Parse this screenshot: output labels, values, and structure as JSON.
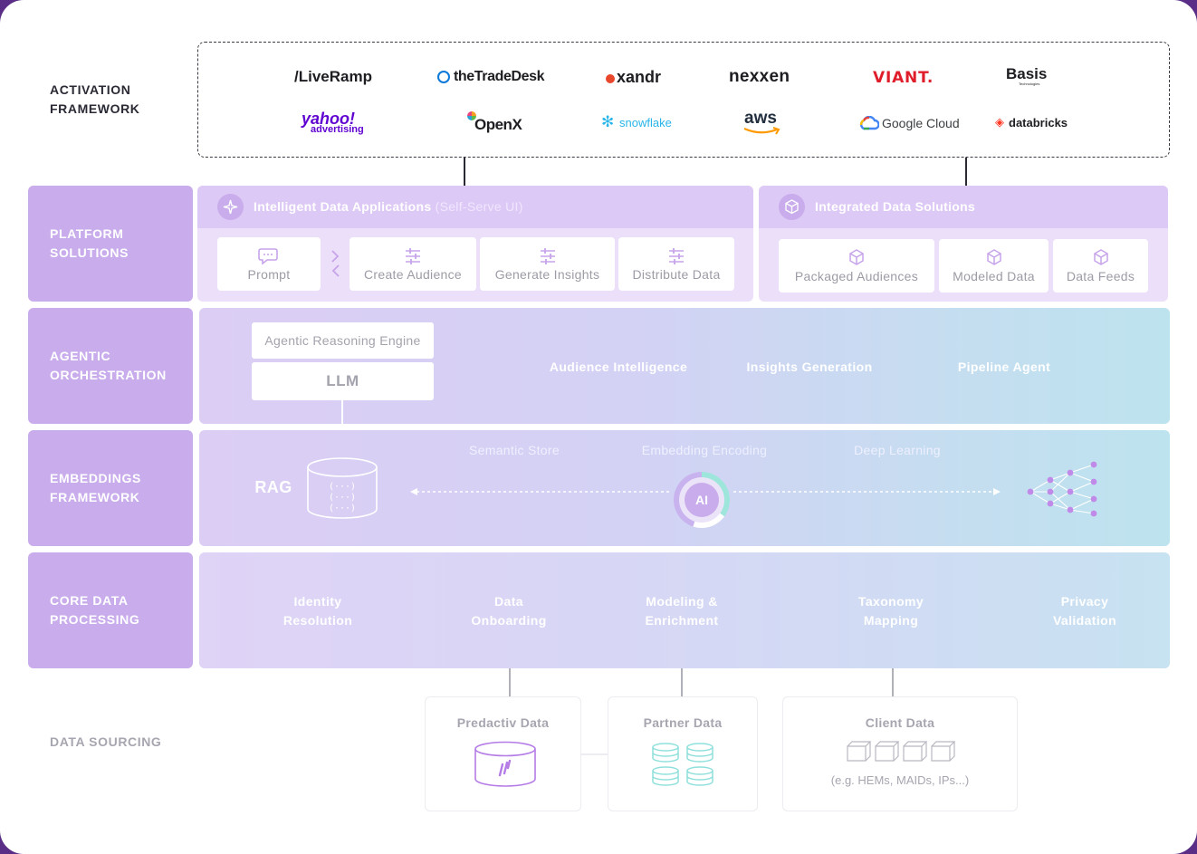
{
  "rows": {
    "activation": "ACTIVATION\nFRAMEWORK",
    "platform": "PLATFORM\nSOLUTIONS",
    "agentic": "AGENTIC\nORCHESTRATION",
    "embeddings": "EMBEDDINGS\nFRAMEWORK",
    "core": "CORE DATA\nPROCESSING",
    "sourcing": "DATA SOURCING"
  },
  "activation_logos": [
    "/LiveRamp",
    "theTradeDesk",
    "xandr",
    "nexxen",
    "VIANT.",
    "Basis",
    "Technologies",
    "yahoo!",
    "advertising",
    "OpenX",
    "snowflake",
    "aws",
    "Google Cloud",
    "databricks"
  ],
  "platform": {
    "apps_title": "Intelligent Data Applications",
    "apps_sub": "(Self-Serve UI)",
    "apps_cards": [
      "Prompt",
      "Create Audience",
      "Generate Insights",
      "Distribute Data"
    ],
    "solutions_title": "Integrated Data Solutions",
    "solutions_cards": [
      "Packaged Audiences",
      "Modeled Data",
      "Data Feeds"
    ]
  },
  "agentic": {
    "engine": "Agentic Reasoning Engine",
    "llm": "LLM",
    "agents": [
      "Audience Intelligence",
      "Insights Generation",
      "Pipeline Agent"
    ]
  },
  "embeddings": {
    "rag": "RAG",
    "labels": [
      "Semantic Store",
      "Embedding Encoding",
      "Deep Learning"
    ],
    "ai": "AI"
  },
  "core": {
    "items": [
      "Identity\nResolution",
      "Data\nOnboarding",
      "Modeling &\nEnrichment",
      "Taxonomy\nMapping",
      "Privacy\nValidation"
    ]
  },
  "sourcing": {
    "predactiv": "Predactiv Data",
    "partner": "Partner Data",
    "client": "Client Data",
    "client_note": "(e.g. HEMs, MAIDs, IPs...)"
  },
  "colors": {
    "label_purple": "#c9acec",
    "accent_purple": "#b47be6",
    "teal": "#8fe0dc",
    "frame": "#5a2d86"
  }
}
